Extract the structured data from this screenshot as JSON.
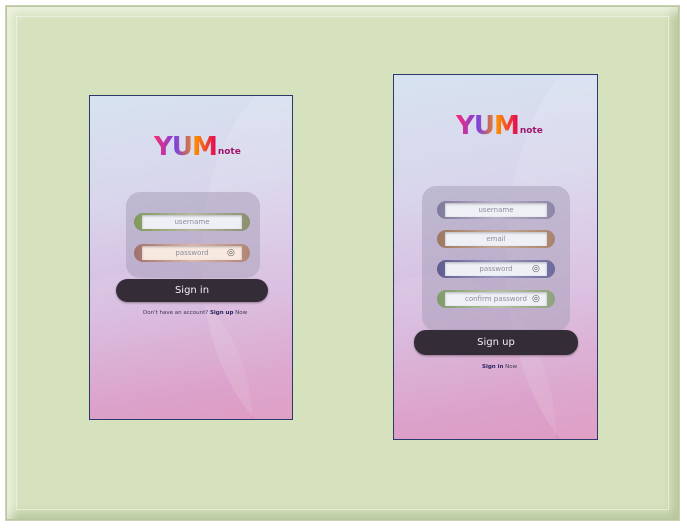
{
  "app": {
    "logo_big": "YUM",
    "logo_small": "note"
  },
  "signin": {
    "username_placeholder": "username",
    "password_placeholder": "password",
    "button": "Sign in",
    "footer_text": "Don't have an account?",
    "footer_link": "Sign up",
    "footer_suffix": "Now"
  },
  "signup": {
    "username_placeholder": "username",
    "email_placeholder": "email",
    "password_placeholder": "password",
    "confirm_placeholder": "confirm password",
    "button": "Sign up",
    "footer_link": "Sign in",
    "footer_suffix": "Now"
  },
  "colors": {
    "button": "#342d37",
    "username_rim": "#8d9a6f",
    "password_rim": "#b78b7a",
    "signup_username_rim": "#8f88a8",
    "email_rim": "#a98a74",
    "signup_password_rim": "#6f6b98",
    "confirm_rim": "#8fa27c"
  }
}
